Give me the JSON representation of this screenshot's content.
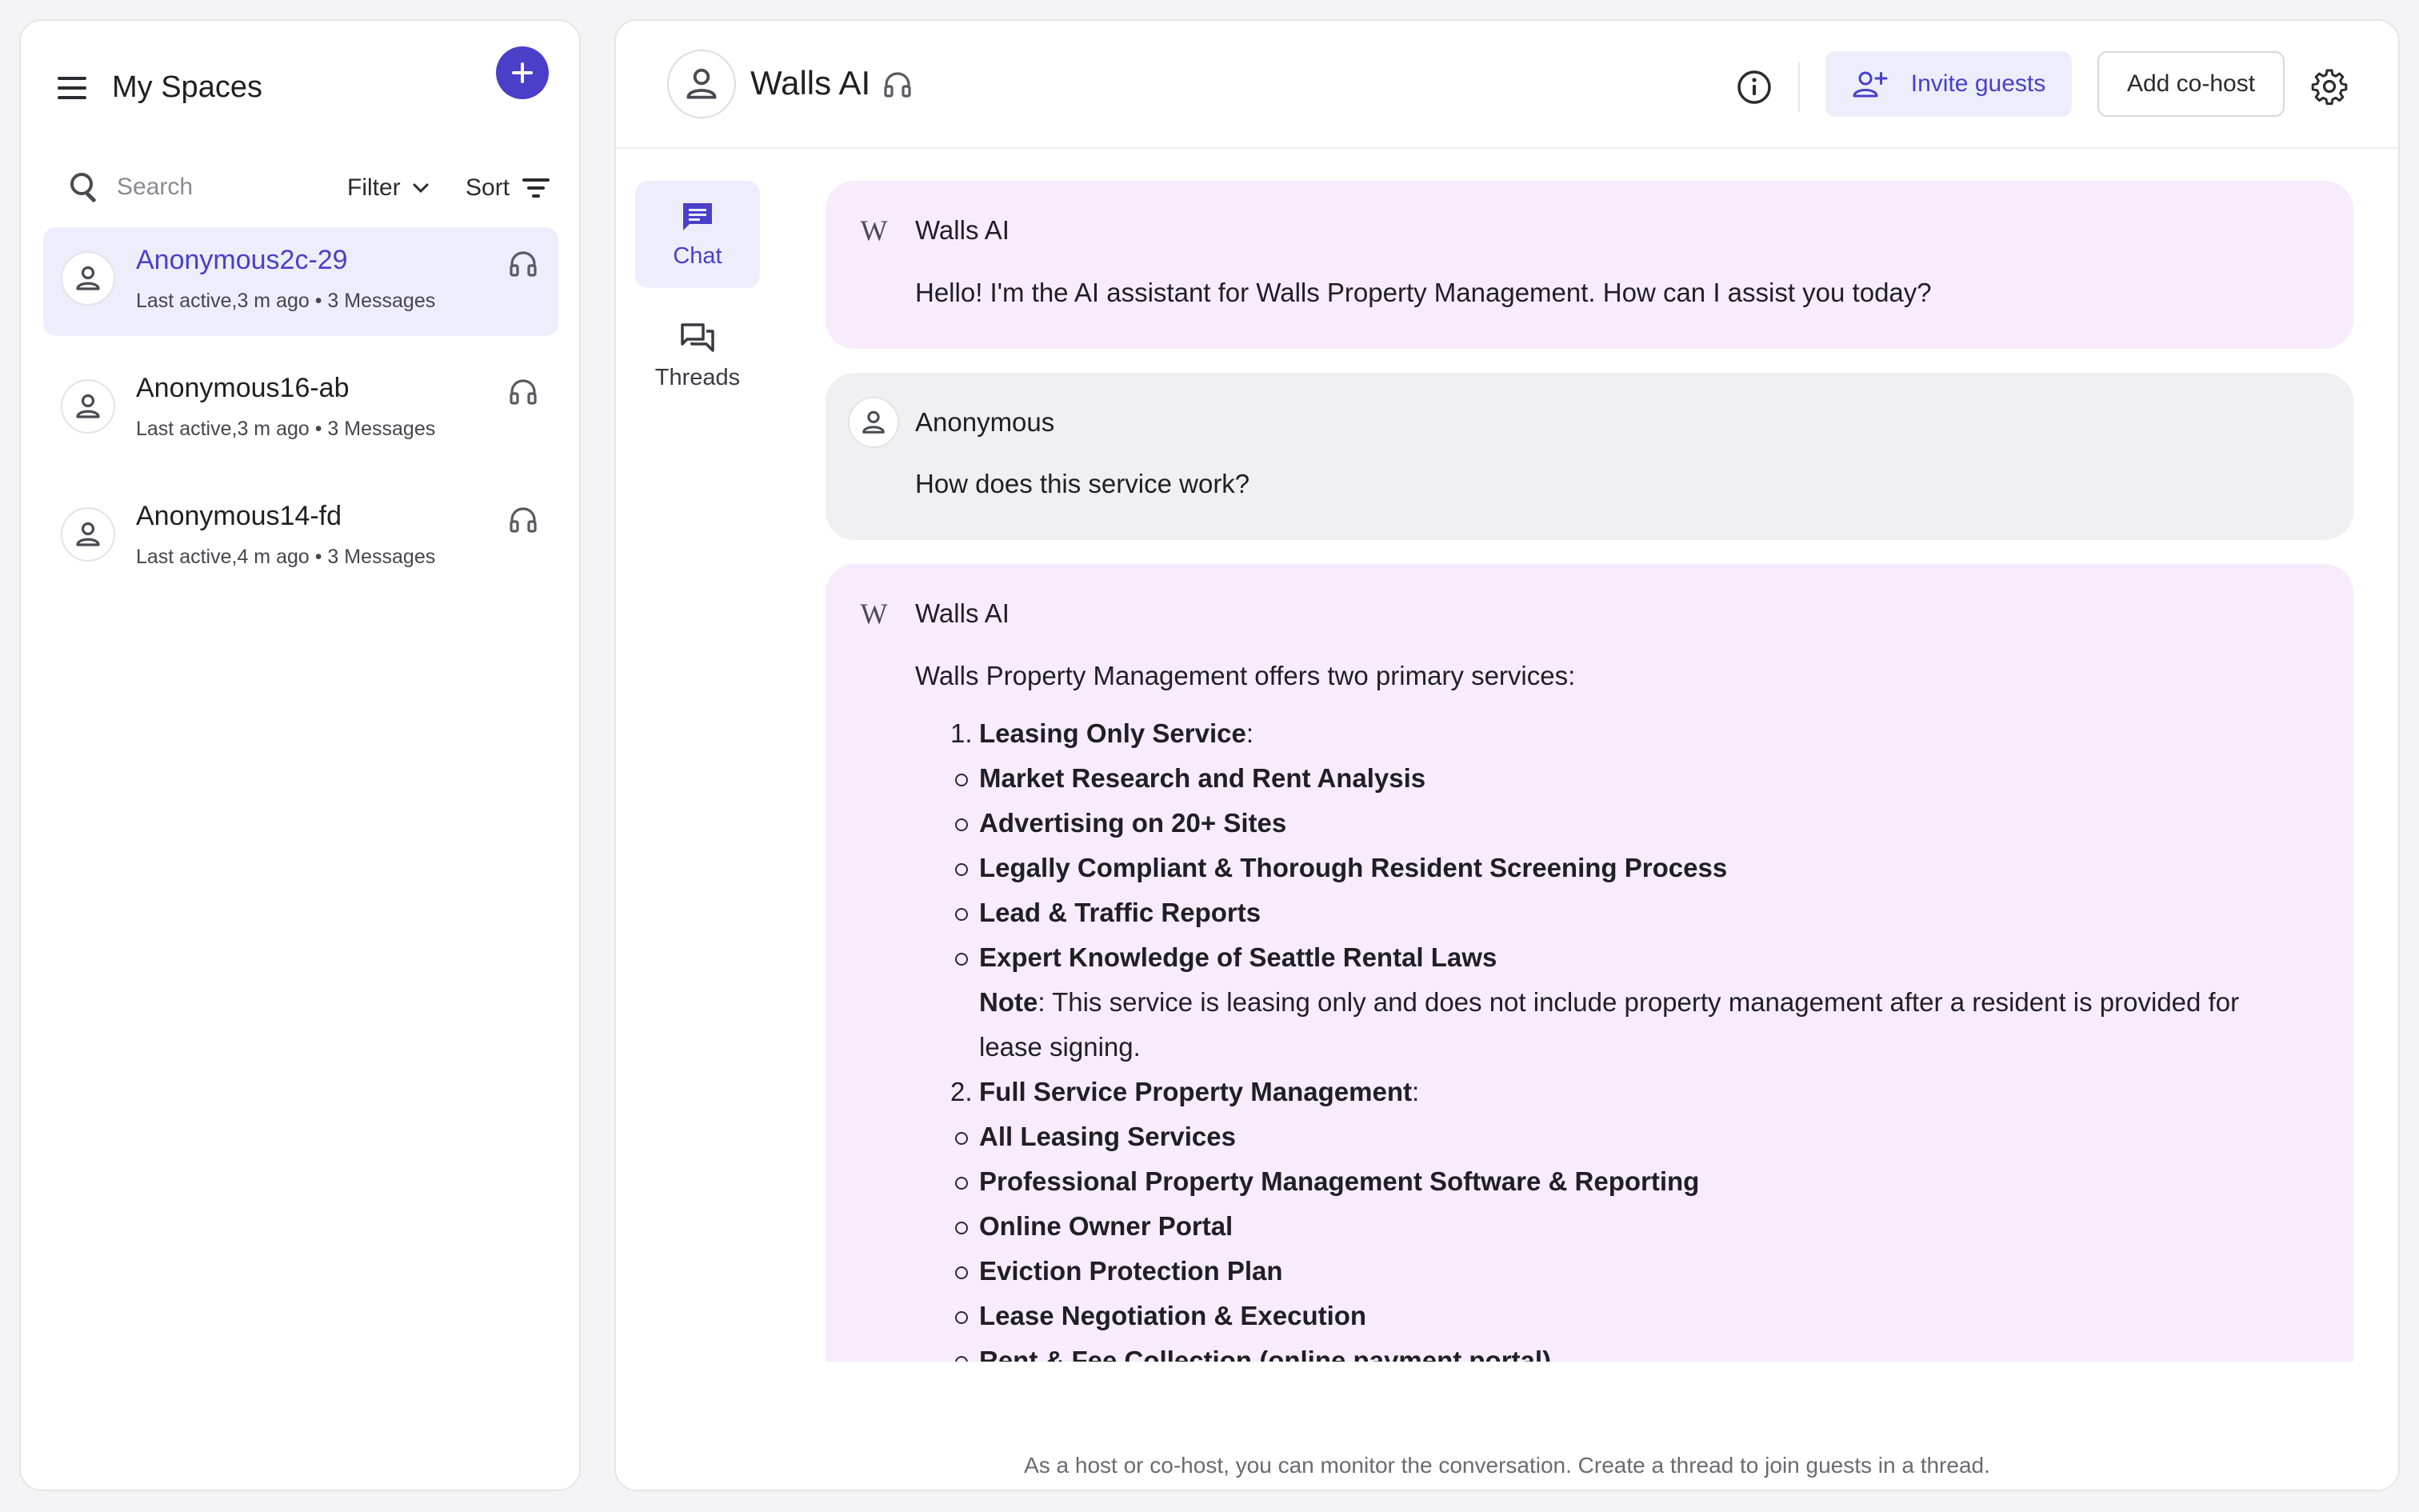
{
  "sidebar": {
    "title": "My Spaces",
    "search_placeholder": "Search",
    "filter_label": "Filter",
    "sort_label": "Sort",
    "conversations": [
      {
        "name": "Anonymous2c-29",
        "meta": "Last active,3 m ago • 3 Messages",
        "active": true
      },
      {
        "name": "Anonymous16-ab",
        "meta": "Last active,3 m ago • 3 Messages",
        "active": false
      },
      {
        "name": "Anonymous14-fd",
        "meta": "Last active,4 m ago • 3 Messages",
        "active": false
      }
    ]
  },
  "header": {
    "title": "Walls AI",
    "invite_label": "Invite guests",
    "cohost_label": "Add co-host"
  },
  "tabs": [
    {
      "label": "Chat",
      "icon": "chat-icon",
      "active": true
    },
    {
      "label": "Threads",
      "icon": "threads-icon",
      "active": false
    }
  ],
  "messages": [
    {
      "author": "Walls AI",
      "type": "ai",
      "text": "Hello! I'm the AI assistant for Walls Property Management. How can I assist you today?"
    },
    {
      "author": "Anonymous",
      "type": "user",
      "text": "How does this service work?"
    },
    {
      "author": "Walls AI",
      "type": "ai",
      "logo_text": "W",
      "intro": "Walls Property Management offers two primary services:",
      "services": [
        {
          "number": "1.",
          "name": "Leasing Only Service",
          "items": [
            "Market Research and Rent Analysis",
            "Advertising on 20+ Sites",
            "Legally Compliant & Thorough Resident Screening Process",
            "Lead & Traffic Reports",
            "Expert Knowledge of Seattle Rental Laws"
          ],
          "note_label": "Note",
          "note_text": ": This service is leasing only and does not include property management after a resident is provided for lease signing."
        },
        {
          "number": "2.",
          "name": "Full Service Property Management",
          "items": [
            "All Leasing Services",
            "Professional Property Management Software & Reporting",
            "Online Owner Portal",
            "Eviction Protection Plan",
            "Lease Negotiation & Execution",
            "Rent & Fee Collection (online payment portal)"
          ]
        }
      ]
    }
  ],
  "footer_note": "As a host or co-host, you can monitor the conversation. Create a thread to join guests in a thread.",
  "colors": {
    "accent": "#4a3fc9",
    "active_bg": "#eceefb",
    "ai_bubble": "#f7ebfc",
    "user_bubble": "#f0f0f2"
  }
}
